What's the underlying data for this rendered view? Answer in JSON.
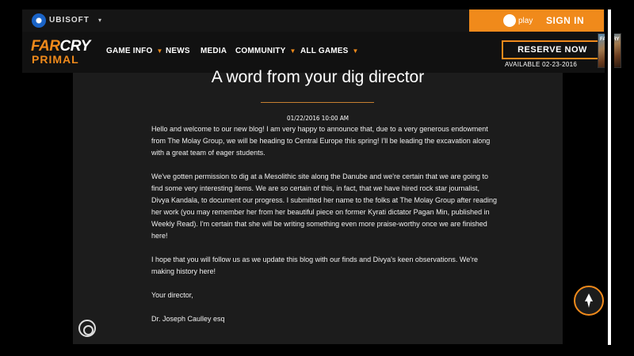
{
  "ubisoft_bar": {
    "brand": "UBISOFT",
    "caret": "▾",
    "uplay_label": "play",
    "sign_in": "SIGN IN"
  },
  "nav": {
    "logo_line1_far": "FAR",
    "logo_line1_cry": "CRY",
    "logo_line2": "PRIMAL",
    "items": [
      {
        "label": "GAME INFO",
        "has_caret": true
      },
      {
        "label": "NEWS",
        "has_caret": false
      },
      {
        "label": "MEDIA",
        "has_caret": false
      },
      {
        "label": "COMMUNITY",
        "has_caret": true
      },
      {
        "label": "ALL GAMES",
        "has_caret": true
      }
    ],
    "caret": "▼",
    "reserve": "RESERVE NOW",
    "available": "AVAILABLE 02-23-2016",
    "boxart_label": "FARCRY"
  },
  "post": {
    "title": "A word from your dig director",
    "date": "01/22/2016 10:00 AM",
    "paragraphs": [
      "Hello and welcome to our new blog! I am very happy to announce that, due to a very generous endowment from The Molay Group, we will be heading to Central Europe this spring! I'll be leading the excavation along with a great team of eager students.",
      "We've gotten permission to dig at a Mesolithic site along the Danube and we're certain that we are going to find some very interesting items. We are so certain of this, in fact, that we have hired rock star journalist, Divya Kandala, to document our progress. I submitted her name to the folks at The Molay Group after reading her work (you may remember her from her beautiful piece on former Kyrati dictator Pagan Min, published in Weekly Read). I'm certain that she will be writing something even more praise-worthy once we are finished here!",
      "I hope that you will follow us as we update this blog with our finds and Divya's keen observations. We're making history here!",
      "Your director,",
      "Dr. Joseph Caulley esq"
    ]
  },
  "colors": {
    "accent": "#f08a1b",
    "panel": "#1c1c1c",
    "topbar": "#151515"
  },
  "icons": {
    "ubisoft": "ubisoft-logo-icon",
    "uplay": "uplay-icon",
    "ring": "ring-icon",
    "fab": "arrowhead-icon"
  }
}
